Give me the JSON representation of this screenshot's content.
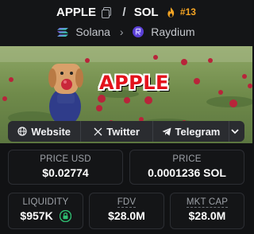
{
  "token": {
    "base_symbol": "APPLE",
    "separator": "/",
    "quote_symbol": "SOL",
    "rank": "#13"
  },
  "chain": {
    "network": "Solana",
    "dex": "Raydium"
  },
  "banner": {
    "overlay_text": "APPLE"
  },
  "social": {
    "website_label": "Website",
    "x_label": "Twitter",
    "telegram_label": "Telegram"
  },
  "stats": {
    "price_usd_label": "PRICE USD",
    "price_usd_value": "$0.02774",
    "price_label": "PRICE",
    "price_value": "0.0001236 SOL",
    "liquidity_label": "LIQUIDITY",
    "liquidity_value": "$957K",
    "fdv_label": "FDV",
    "fdv_value": "$28.0M",
    "mcap_label": "MKT CAP",
    "mcap_value": "$28.0M"
  },
  "icons": [
    "copy-icon",
    "flame-icon",
    "solana-icon",
    "chevron-right-icon",
    "raydium-icon",
    "globe-icon",
    "x-icon",
    "telegram-icon",
    "chevron-down-icon",
    "lock-icon"
  ],
  "colors": {
    "background": "#111214",
    "rank_accent": "#f5a524",
    "banner_text": "#e3121b",
    "lock_green": "#2fbf71"
  }
}
